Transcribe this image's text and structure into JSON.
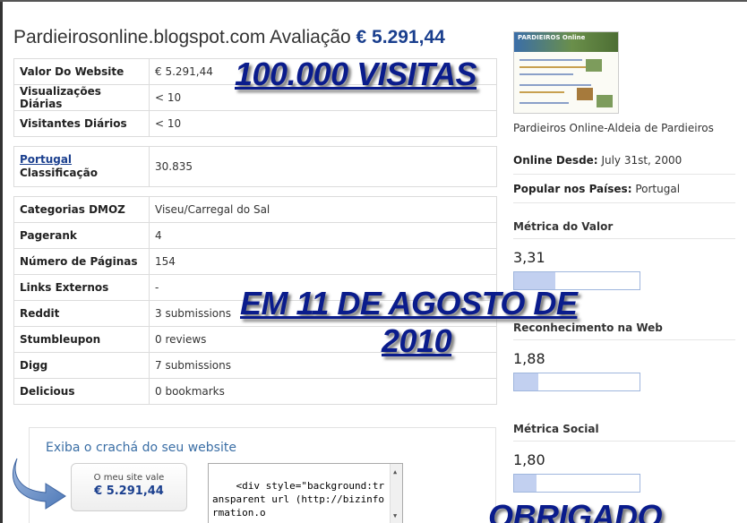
{
  "header": {
    "site": "Pardieirosonline.blogspot.com",
    "label": "Avaliação",
    "price": "€ 5.291,44"
  },
  "table1": [
    {
      "k": "Valor Do Website",
      "v": "€ 5.291,44"
    },
    {
      "k": "Visualizações Diárias",
      "v": "< 10"
    },
    {
      "k": "Visitantes Diários",
      "v": "< 10"
    }
  ],
  "table2": {
    "country_link": "Portugal",
    "rank_label": "Classificação",
    "rank_value": "30.835"
  },
  "table3": [
    {
      "k": "Categorias DMOZ",
      "v": "Viseu/Carregal do Sal"
    },
    {
      "k": "Pagerank",
      "v": "4"
    },
    {
      "k": "Número de Páginas",
      "v": "154"
    },
    {
      "k": "Links Externos",
      "v": "-"
    },
    {
      "k": "Reddit",
      "v": "3 submissions"
    },
    {
      "k": "Stumbleupon",
      "v": "0 reviews"
    },
    {
      "k": "Digg",
      "v": "7 submissions"
    },
    {
      "k": "Delicious",
      "v": "0 bookmarks"
    }
  ],
  "overlays": {
    "visits": "100.000 VISITAS",
    "date_line1": "EM 11 DE AGOSTO DE",
    "date_line2": "2010",
    "thanks": "OBRIGADO"
  },
  "badge": {
    "title": "Exiba o crachá do seu website",
    "line1": "O meu site vale",
    "line2": "€ 5.291,44",
    "code": "<div style=\"background:transparent url (http://bizinformation.o"
  },
  "sidebar": {
    "thumb_logo": "PARDIEIROS Online",
    "site_desc": "Pardieiros Online-Aldeia de Pardieiros",
    "online_label": "Online Desde:",
    "online_value": "July 31st, 2000",
    "popular_label": "Popular nos Países:",
    "popular_value": "Portugal",
    "metrics": [
      {
        "label": "Métrica do Valor",
        "value": "3,31",
        "fill": 0.33
      },
      {
        "label": "Reconhecimento na Web",
        "value": "1,88",
        "fill": 0.19
      },
      {
        "label": "Métrica Social",
        "value": "1,80",
        "fill": 0.18
      }
    ]
  },
  "colors": {
    "link_blue": "#1a3f8e",
    "overlay_blue": "#0a1c8c",
    "bar_fill": "#c2d0f0"
  }
}
